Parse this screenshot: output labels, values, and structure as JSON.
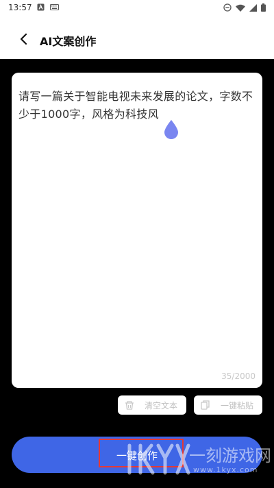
{
  "status_bar": {
    "time": "13:57",
    "left_icons": [
      "a-box-icon",
      "keyboard-icon"
    ],
    "right_icons": [
      "do-not-disturb-icon",
      "wifi-icon",
      "signal-icon",
      "battery-icon"
    ]
  },
  "header": {
    "title": "AI文案创作",
    "back_icon": "chevron-left-icon"
  },
  "editor": {
    "text": "请写一篇关于智能电视未来发展的论文，字数不少于1000字，风格为科技风",
    "char_count": "35/2000"
  },
  "actions": {
    "clear_label": "清空文本",
    "clear_icon": "trash-icon",
    "paste_label": "一键粘贴",
    "paste_icon": "copy-icon"
  },
  "create_button": {
    "label": "一键创作"
  },
  "watermark": {
    "logo": "1KYX",
    "name": "一刻游戏网",
    "url": "www.1kyx.com"
  },
  "colors": {
    "accent": "#3f66e6",
    "cursor_handle": "#7a86f0",
    "highlight": "#e53935"
  }
}
